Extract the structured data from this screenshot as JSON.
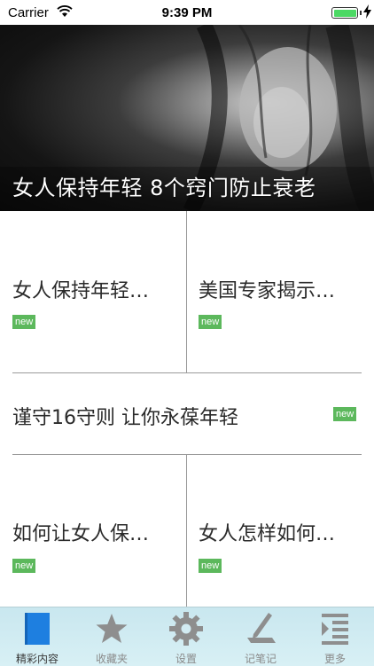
{
  "status_bar": {
    "carrier": "Carrier",
    "time": "9:39 PM"
  },
  "hero": {
    "title": "女人保持年轻 8个窍门防止衰老"
  },
  "articles": [
    {
      "title": "女人保持年轻…",
      "badge": "new"
    },
    {
      "title": "美国专家揭示…",
      "badge": "new"
    },
    {
      "title": "谨守16守则 让你永葆年轻",
      "badge": "new"
    },
    {
      "title": "如何让女人保…",
      "badge": "new"
    },
    {
      "title": "女人怎样如何…",
      "badge": "new"
    }
  ],
  "tabbar": {
    "items": [
      {
        "label": "精彩内容",
        "icon": "book-icon",
        "active": true
      },
      {
        "label": "收藏夹",
        "icon": "star-icon",
        "active": false
      },
      {
        "label": "设置",
        "icon": "gear-icon",
        "active": false
      },
      {
        "label": "记笔记",
        "icon": "notepad-icon",
        "active": false
      },
      {
        "label": "更多",
        "icon": "list-icon",
        "active": false
      }
    ]
  }
}
